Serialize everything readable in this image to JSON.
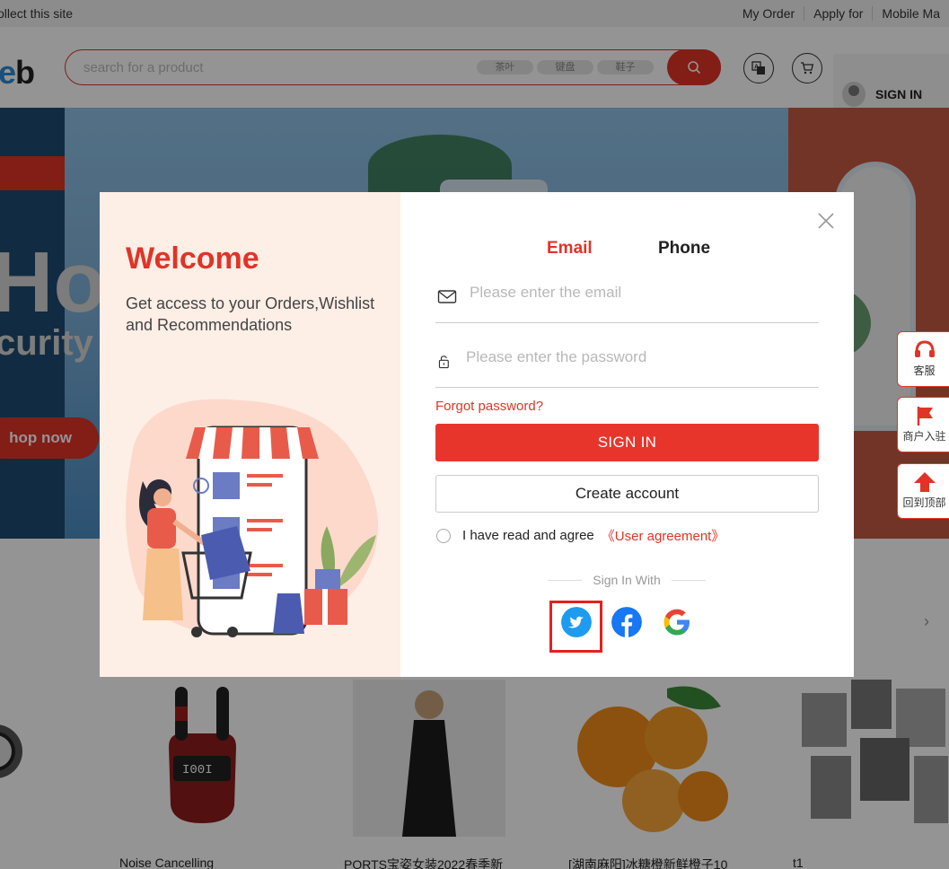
{
  "topbar": {
    "collect": "ollect this site",
    "links": [
      "My Order",
      "Apply for",
      "Mobile Ma"
    ]
  },
  "header": {
    "logo_left": "e",
    "logo_right": "b",
    "search_placeholder": "search for a product",
    "search_tags": [
      "茶叶",
      "键盘",
      "鞋子"
    ],
    "sign_in": "SIGN IN",
    "translate_icon": "translate-icon",
    "cart_icon": "cart-icon"
  },
  "banner": {
    "headline": "Hot-",
    "subline": "curity",
    "shop_now": "hop now"
  },
  "side_float": [
    {
      "label": "客服",
      "icon": "headset-icon"
    },
    {
      "label": "商户入驻",
      "icon": "flag-icon"
    },
    {
      "label": "回到顶部",
      "icon": "arrow-up-icon"
    }
  ],
  "products": [
    {
      "caption": ""
    },
    {
      "caption": "Noise Cancelling"
    },
    {
      "caption": "PORTS宝姿女装2022春季新"
    },
    {
      "caption": "[湖南麻阳]冰糖橙新鲜橙子10"
    },
    {
      "caption": "t1"
    }
  ],
  "modal": {
    "welcome": "Welcome",
    "subtitle": "Get access to your Orders,Wishlist and Recommendations",
    "tabs": {
      "email": "Email",
      "phone": "Phone"
    },
    "email_placeholder": "Please enter the email",
    "password_placeholder": "Please enter the password",
    "forgot": "Forgot password?",
    "sign_in": "SIGN IN",
    "create_account": "Create account",
    "agree_text": "I have read and agree",
    "user_agreement": "《User agreement》",
    "sign_in_with": "Sign In With",
    "colors": {
      "accent": "#e03427",
      "twitter": "#1d9bf0",
      "facebook": "#1877f2"
    }
  }
}
